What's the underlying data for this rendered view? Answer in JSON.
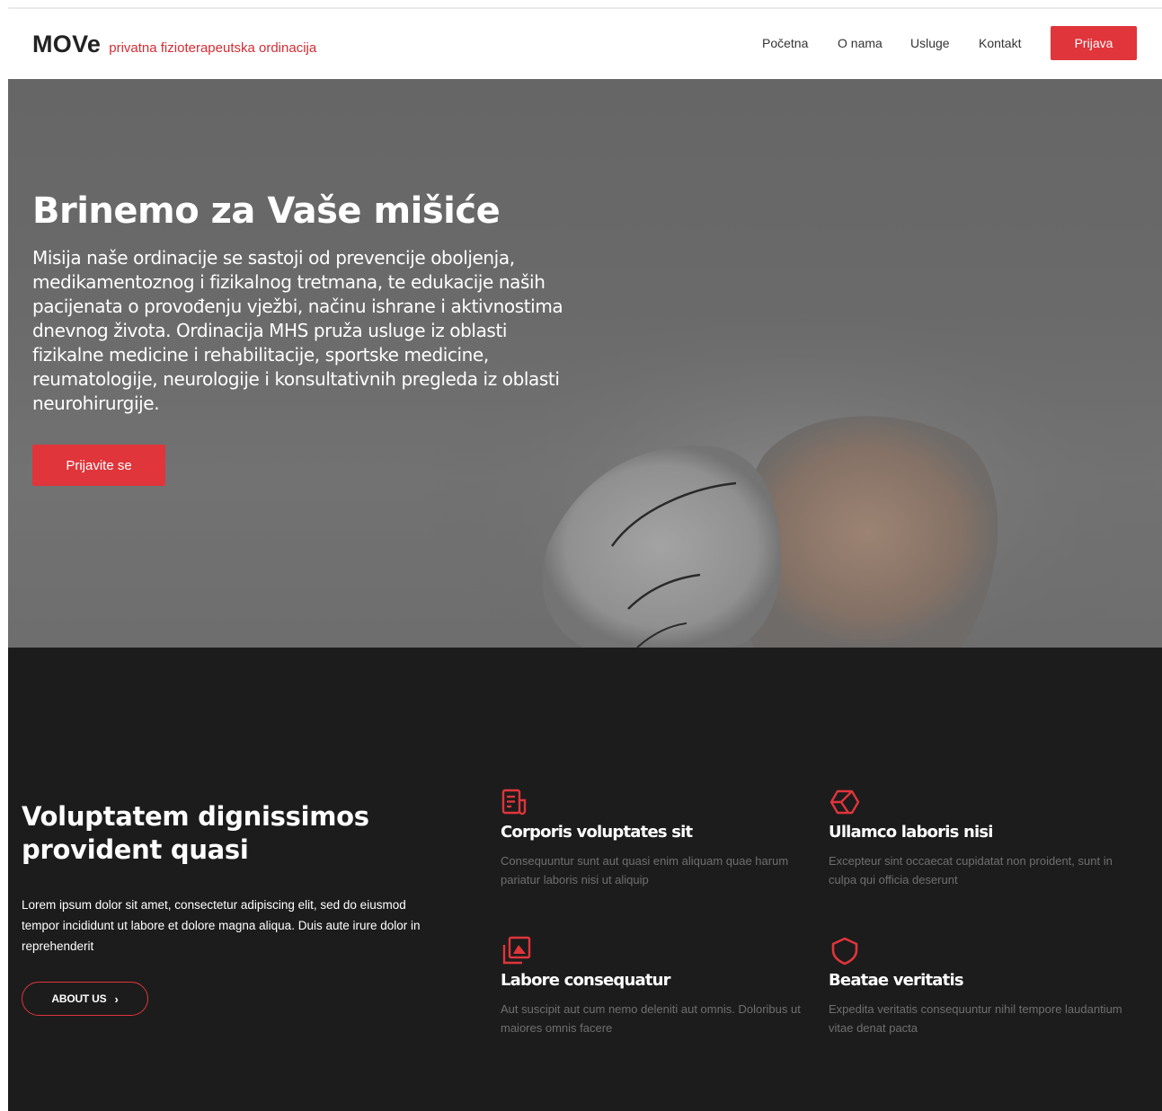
{
  "brand": {
    "name": "MOVe",
    "tagline": "privatna fizioterapeutska ordinacija"
  },
  "nav": {
    "items": [
      {
        "label": "Početna"
      },
      {
        "label": "O nama"
      },
      {
        "label": "Usluge"
      },
      {
        "label": "Kontakt"
      }
    ],
    "cta_label": "Prijava"
  },
  "hero": {
    "title": "Brinemo za Vaše mišiće",
    "text": "Misija naše ordinacije se sastoji od prevencije oboljenja, medikamentoznog i fizikalnog tretmana, te edukacije naših pacijenata o provođenju vježbi, načinu ishrane i aktivnostima dnevnog života. Ordinacija MHS pruža usluge iz oblasti fizikalne medicine i rehabilitacije, sportske medicine, reumatologije, neurologije i konsultativnih pregleda iz oblasti neurohirurgije.",
    "cta_label": "Prijavite se"
  },
  "about": {
    "title": "Voluptatem dignissimos provident quasi",
    "text": "Lorem ipsum dolor sit amet, consectetur adipiscing elit, sed do eiusmod tempor incididunt ut labore et dolore magna aliqua. Duis aute irure dolor in reprehenderit",
    "button_label": "ABOUT US",
    "button_icon": "chevron-right-icon"
  },
  "features": [
    {
      "icon": "document-icon",
      "title": "Corporis voluptates sit",
      "text": "Consequuntur sunt aut quasi enim aliquam quae harum pariatur laboris nisi ut aliquip"
    },
    {
      "icon": "cube-icon",
      "title": "Ullamco laboris nisi",
      "text": "Excepteur sint occaecat cupidatat non proident, sunt in culpa qui officia deserunt"
    },
    {
      "icon": "images-icon",
      "title": "Labore consequatur",
      "text": "Aut suscipit aut cum nemo deleniti aut omnis. Doloribus ut maiores omnis facere"
    },
    {
      "icon": "shield-icon",
      "title": "Beatae veritatis",
      "text": "Expedita veritatis consequuntur nihil tempore laudantium vitae denat pacta"
    }
  ],
  "colors": {
    "accent": "#e0353b",
    "hero_overlay": "#666666",
    "dark_section": "#1c1c1c",
    "muted_text": "#6f6f6f"
  }
}
